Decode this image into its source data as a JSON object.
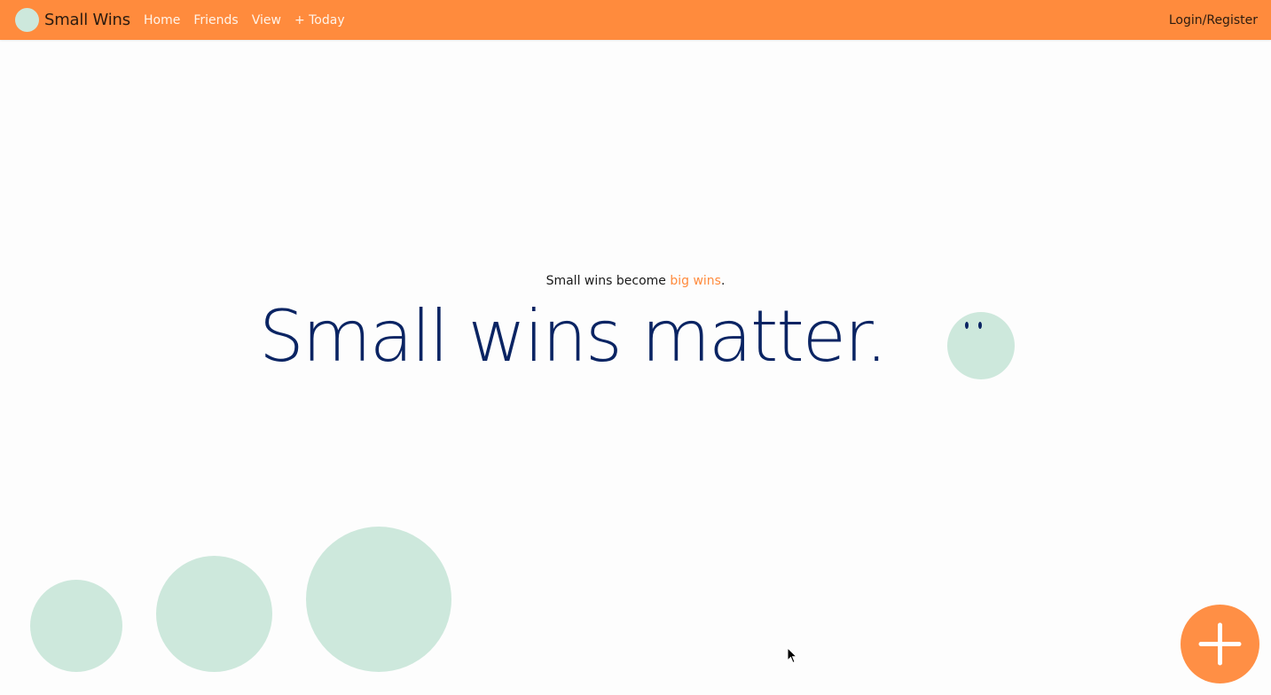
{
  "brand": {
    "name": "Small Wins"
  },
  "nav": {
    "items": [
      {
        "label": "Home"
      },
      {
        "label": "Friends"
      },
      {
        "label": "View"
      },
      {
        "label": "+ Today"
      }
    ],
    "auth_label": "Login/Register"
  },
  "hero": {
    "tagline_prefix": "Small wins become ",
    "tagline_accent": "big wins",
    "tagline_suffix": ".",
    "headline": "Small wins matter."
  },
  "colors": {
    "navbar": "#ff8b3d",
    "accent": "#ff8b3d",
    "headline": "#0a2463",
    "mint": "#cde8dc",
    "fab": "#ff8f45"
  },
  "icons": {
    "logo": "mint-circle-logo",
    "mascot": "smiley-face-icon",
    "fab": "plus-icon",
    "cursor": "mouse-pointer-icon"
  }
}
